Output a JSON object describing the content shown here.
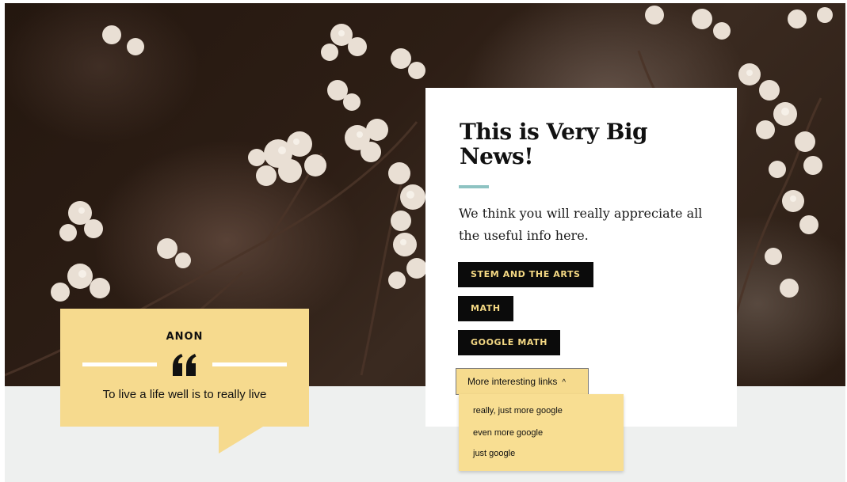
{
  "news": {
    "title": "This is Very Big News!",
    "body": "We think you will really appreciate all the useful info here.",
    "tags": [
      "STEM AND THE ARTS",
      "MATH",
      "GOOGLE MATH"
    ]
  },
  "dropdown": {
    "label": "More interesting links",
    "expanded": true,
    "items": [
      "really, just more google",
      "even more google",
      "just google"
    ]
  },
  "quote": {
    "author": "ANON",
    "text": "To live a life well is to really live",
    "icon": "quote-icon"
  },
  "colors": {
    "accent_teal": "#8ec3c2",
    "tag_text": "#f5d984",
    "quote_bg": "#f6da8e",
    "floor_bg": "#eef0ef"
  }
}
